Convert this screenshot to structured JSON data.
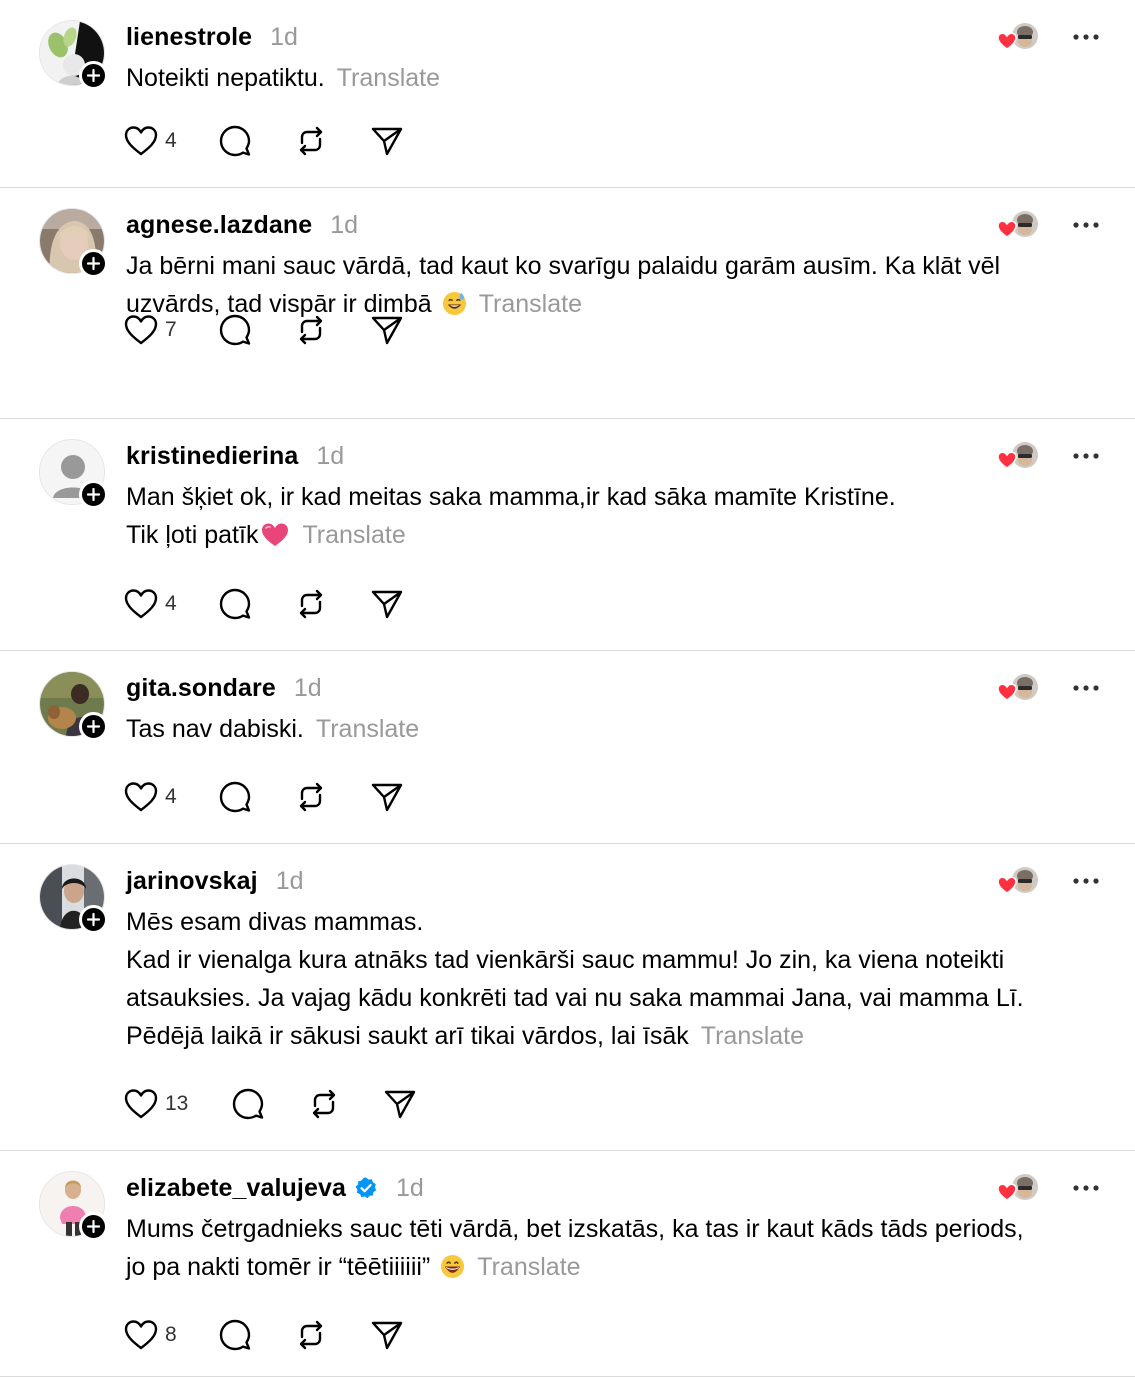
{
  "posts": [
    {
      "username": "lienestrole",
      "verified": false,
      "time": "1d",
      "lines": [
        "Noteikti nepatiktu."
      ],
      "emoji": null,
      "translate": "Translate",
      "likes": "4",
      "avatar": "leaves-photo"
    },
    {
      "username": "agnese.lazdane",
      "verified": false,
      "time": "1d",
      "lines": [
        "Ja bērni mani sauc vārdā, tad kaut ko svarīgu palaidu garām ausīm. Ka klāt vēl",
        "uzvārds, tad vispār ir dimbā"
      ],
      "emoji": "sweat-smile-emoji",
      "translate": "Translate",
      "likes": "7",
      "avatar": "blonde-photo"
    },
    {
      "username": "kristinedierina",
      "verified": false,
      "time": "1d",
      "lines": [
        "Man šķiet ok, ir kad meitas saka mamma,ir kad sāka mamīte Kristīne.",
        "Tik ļoti patīk"
      ],
      "emoji": "pink-heart-emoji",
      "translate": "Translate",
      "likes": "4",
      "avatar": "default-user"
    },
    {
      "username": "gita.sondare",
      "verified": false,
      "time": "1d",
      "lines": [
        "Tas nav dabiski."
      ],
      "emoji": null,
      "translate": "Translate",
      "likes": "4",
      "avatar": "dog-photo"
    },
    {
      "username": "jarinovskaj",
      "verified": false,
      "time": "1d",
      "lines": [
        "Mēs esam divas mammas.",
        "Kad ir vienalga kura atnāks tad vienkārši sauc mammu! Jo zin, ka viena noteikti",
        "atsauksies. Ja vajag kādu konkrēti tad vai nu saka mammai Jana, vai mamma Lī.",
        "Pēdējā laikā ir sākusi saukt arī tikai vārdos, lai īsāk"
      ],
      "emoji": null,
      "translate": "Translate",
      "likes": "13",
      "avatar": "street-photo"
    },
    {
      "username": "elizabete_valujeva",
      "verified": true,
      "time": "1d",
      "lines": [
        "Mums četrgadnieks sauc tēti vārdā, bet izskatās, ka tas ir kaut kāds tāds periods,",
        "jo pa nakti tomēr ir “tēētiiiiii”"
      ],
      "emoji": "grinning-emoji",
      "translate": "Translate",
      "likes": "8",
      "avatar": "pink-photo"
    }
  ],
  "colors": {
    "text": "#000000",
    "muted": "#999999",
    "divider": "#dbdbdb",
    "reaction_heart": "#ff3040",
    "verified_badge": "#0095f6"
  },
  "icons": {
    "like": "heart-outline-icon",
    "reply": "comment-bubble-icon",
    "repost": "repost-icon",
    "share": "send-icon",
    "more": "more-dots-icon",
    "follow": "plus-icon"
  }
}
